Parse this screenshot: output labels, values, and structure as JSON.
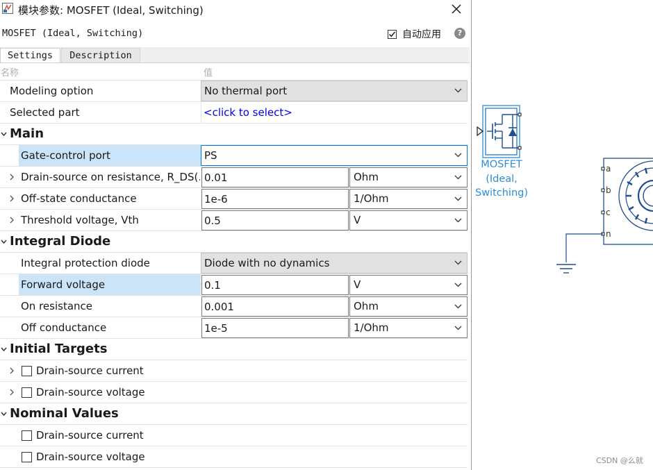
{
  "window": {
    "title": "模块参数: MOSFET (Ideal, Switching)",
    "block_name": "MOSFET (Ideal, Switching)",
    "auto_apply_label": "自动应用",
    "auto_apply_checked": true
  },
  "tabs": [
    {
      "label": "Settings",
      "active": true
    },
    {
      "label": "Description",
      "active": false
    }
  ],
  "columns": {
    "name": "名称",
    "value": "值"
  },
  "rows": {
    "modeling_option": {
      "label": "Modeling option",
      "value": "No thermal port"
    },
    "selected_part": {
      "label": "Selected part",
      "value": "<click to select>"
    },
    "main_section": {
      "label": "Main"
    },
    "gate_control": {
      "label": "Gate-control port",
      "value": "PS"
    },
    "rds_on": {
      "label": "Drain-source on resistance, R_DS(…",
      "value": "0.01",
      "unit": "Ohm"
    },
    "off_conductance": {
      "label": "Off-state conductance",
      "value": "1e-6",
      "unit": "1/Ohm"
    },
    "vth": {
      "label": "Threshold voltage, Vth",
      "value": "0.5",
      "unit": "V"
    },
    "diode_section": {
      "label": "Integral Diode"
    },
    "protection_diode": {
      "label": "Integral protection diode",
      "value": "Diode with no dynamics"
    },
    "forward_voltage": {
      "label": "Forward voltage",
      "value": "0.1",
      "unit": "V"
    },
    "on_resistance": {
      "label": "On resistance",
      "value": "0.001",
      "unit": "Ohm"
    },
    "diode_off_conductance": {
      "label": "Off conductance",
      "value": "1e-5",
      "unit": "1/Ohm"
    },
    "initial_section": {
      "label": "Initial Targets"
    },
    "init_current": {
      "label": "Drain-source current",
      "checked": false
    },
    "init_voltage": {
      "label": "Drain-source voltage",
      "checked": false
    },
    "nominal_section": {
      "label": "Nominal Values"
    },
    "nom_current": {
      "label": "Drain-source current",
      "checked": false
    },
    "nom_voltage": {
      "label": "Drain-source voltage",
      "checked": false
    }
  },
  "canvas": {
    "mosfet_block_label_1": "MOSFET",
    "mosfet_block_label_2": "(Ideal,",
    "mosfet_block_label_3": "Switching)",
    "port_labels": [
      "a",
      "b",
      "c",
      "n"
    ],
    "accent_color": "#2c8dd6"
  },
  "watermark": "CSDN @么就"
}
